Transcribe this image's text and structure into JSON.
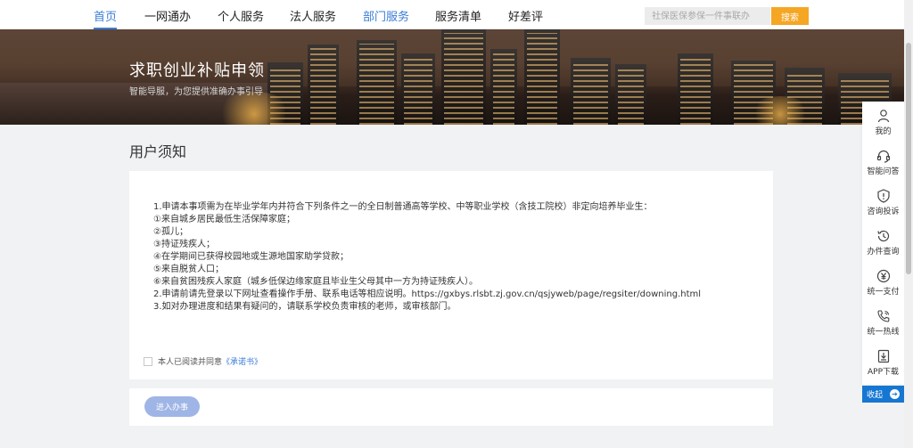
{
  "nav": {
    "items": [
      {
        "label": "首页"
      },
      {
        "label": "一网通办"
      },
      {
        "label": "个人服务"
      },
      {
        "label": "法人服务"
      },
      {
        "label": "部门服务"
      },
      {
        "label": "服务清单"
      },
      {
        "label": "好差评"
      }
    ],
    "search_placeholder": "社保医保参保一件事联办",
    "search_button": "搜索"
  },
  "banner": {
    "title": "求职创业补贴申领",
    "subtitle": "智能导服，为您提供准确办事引导"
  },
  "notice": {
    "section_title": "用户须知",
    "lines": [
      "1.申请本事项需为在毕业学年内并符合下列条件之一的全日制普通高等学校、中等职业学校（含技工院校）非定向培养毕业生：",
      "①来自城乡居民最低生活保障家庭；",
      "②孤儿；",
      "③持证残疾人；",
      "④在学期间已获得校园地或生源地国家助学贷款；",
      "⑤来自脱贫人口；",
      "⑥来自贫困残疾人家庭（城乡低保边缘家庭且毕业生父母其中一方为持证残疾人）。",
      "2.申请前请先登录以下网址查看操作手册、联系电话等相应说明。https://gxbys.rlsbt.zj.gov.cn/qsjyweb/page/regsiter/downing.html",
      "3.如对办理进度和结果有疑问的，请联系学校负责审核的老师，或审核部门。"
    ],
    "agree_text": "本人已阅读并同意",
    "agree_link": "《承诺书》",
    "agree_checked": false
  },
  "actions": {
    "enter_button": "进入办事"
  },
  "side_panel": {
    "items": [
      {
        "label": "我的",
        "icon": "user-icon"
      },
      {
        "label": "智能问答",
        "icon": "headset-icon"
      },
      {
        "label": "咨询投诉",
        "icon": "shield-icon"
      },
      {
        "label": "办件查询",
        "icon": "history-icon"
      },
      {
        "label": "统一支付",
        "icon": "yen-icon"
      },
      {
        "label": "统一热线",
        "icon": "phone-icon"
      },
      {
        "label": "APP下载",
        "icon": "download-icon"
      }
    ],
    "collapse_label": "收起"
  },
  "colors": {
    "accent": "#3b7dd8",
    "search_button": "#f5a623",
    "collapse_button": "#1677d2",
    "enter_button": "#9fb5e6"
  }
}
